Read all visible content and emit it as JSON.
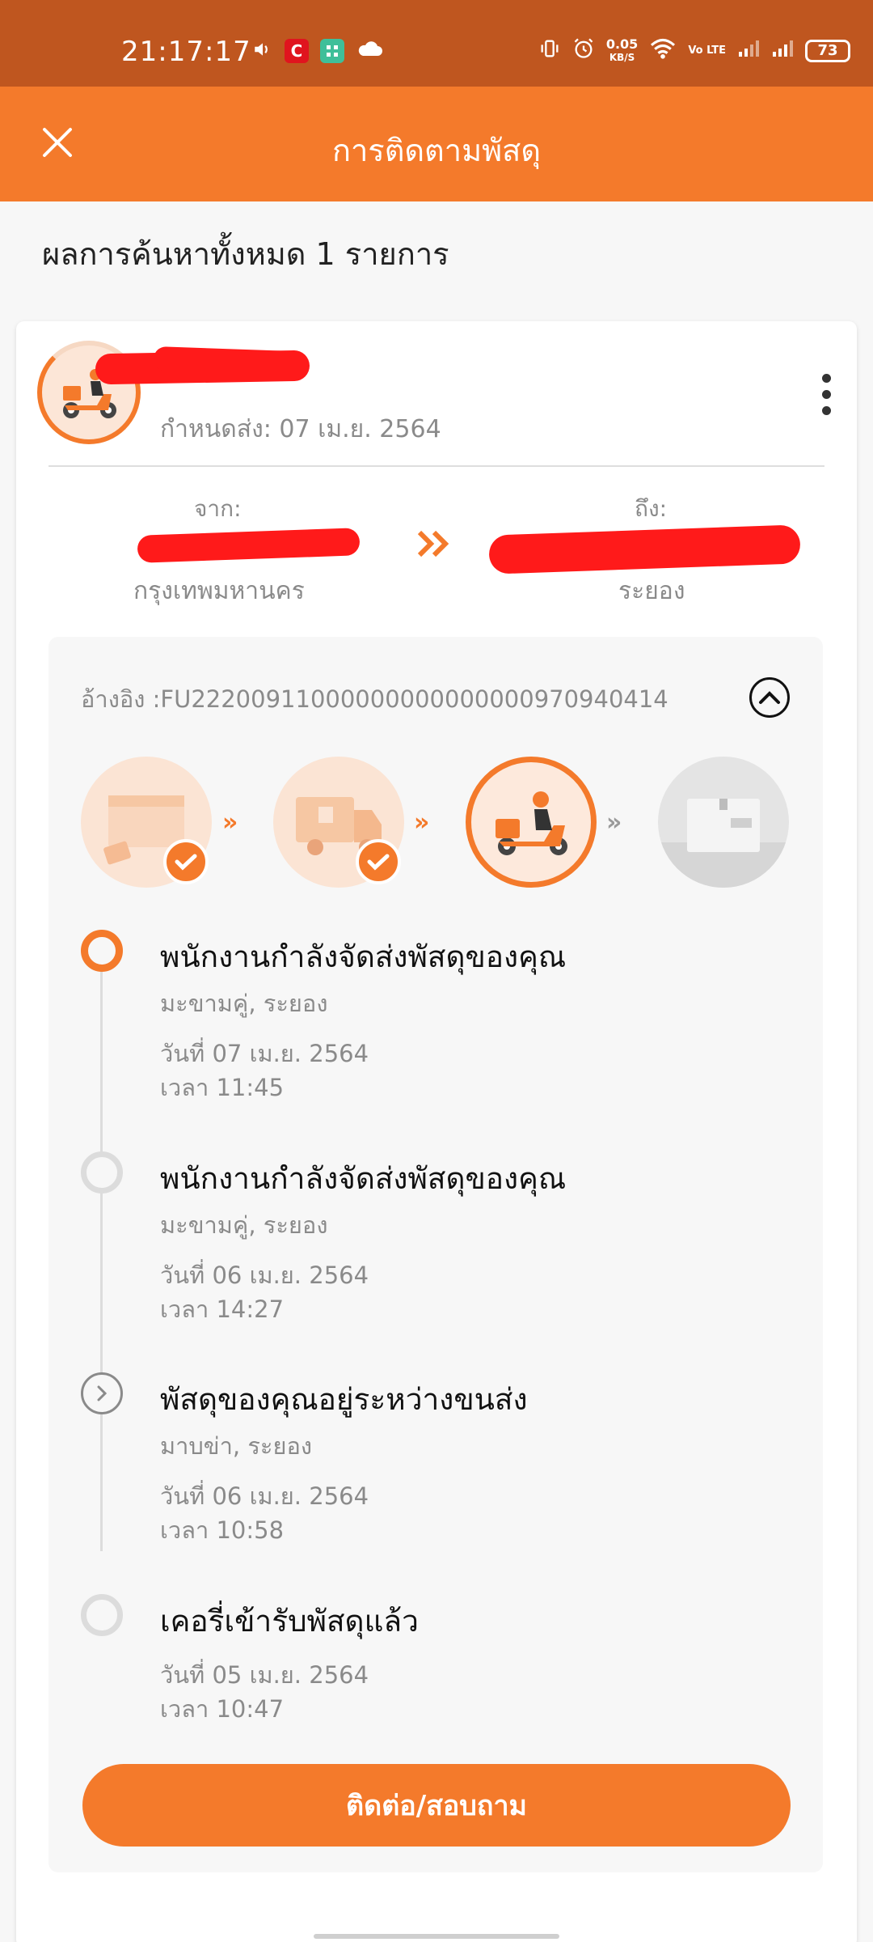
{
  "status_bar": {
    "time": "21:17:17",
    "net_speed": "0.05",
    "net_unit": "KB/S",
    "volte": "Vo LTE",
    "battery": "73"
  },
  "app_bar": {
    "title": "การติดตามพัสดุ"
  },
  "results": {
    "count_text": "ผลการค้นหาทั้งหมด 1 รายการ"
  },
  "shipment": {
    "due_date": "กำหนดส่ง: 07 เม.ย. 2564",
    "from_label": "จาก:",
    "from_city": "กรุงเทพมหานคร",
    "to_label": "ถึง:",
    "to_city": "ระยอง",
    "reference": "อ้างอิง :FU22200911000000000000000970940414"
  },
  "progress_steps": [
    {
      "name": "picked-up",
      "done": true
    },
    {
      "name": "in-transit",
      "done": true
    },
    {
      "name": "out-for-delivery",
      "done": false,
      "current": true
    },
    {
      "name": "delivered",
      "done": false
    }
  ],
  "timeline": [
    {
      "title": "พนักงานกำลังจัดส่งพัสดุของคุณ",
      "location": "มะขามคู่, ระยอง",
      "date": "วันที่ 07 เม.ย. 2564",
      "time": "เวลา 11:45",
      "state": "current"
    },
    {
      "title": "พนักงานกำลังจัดส่งพัสดุของคุณ",
      "location": "มะขามคู่, ระยอง",
      "date": "วันที่ 06 เม.ย. 2564",
      "time": "เวลา 14:27",
      "state": "past"
    },
    {
      "title": "พัสดุของคุณอยู่ระหว่างขนส่ง",
      "location": "มาบข่า, ระยอง",
      "date": "วันที่ 06 เม.ย. 2564",
      "time": "เวลา 10:58",
      "state": "transit"
    },
    {
      "title": "เคอรี่เข้ารับพัสดุแล้ว",
      "date": "วันที่ 05 เม.ย. 2564",
      "time": "เวลา 10:47",
      "state": "past"
    }
  ],
  "actions": {
    "contact_label": "ติดต่อ/สอบถาม"
  },
  "colors": {
    "accent": "#f47a2b",
    "status_bar": "#bf561f",
    "redaction": "#ff1a1a"
  }
}
